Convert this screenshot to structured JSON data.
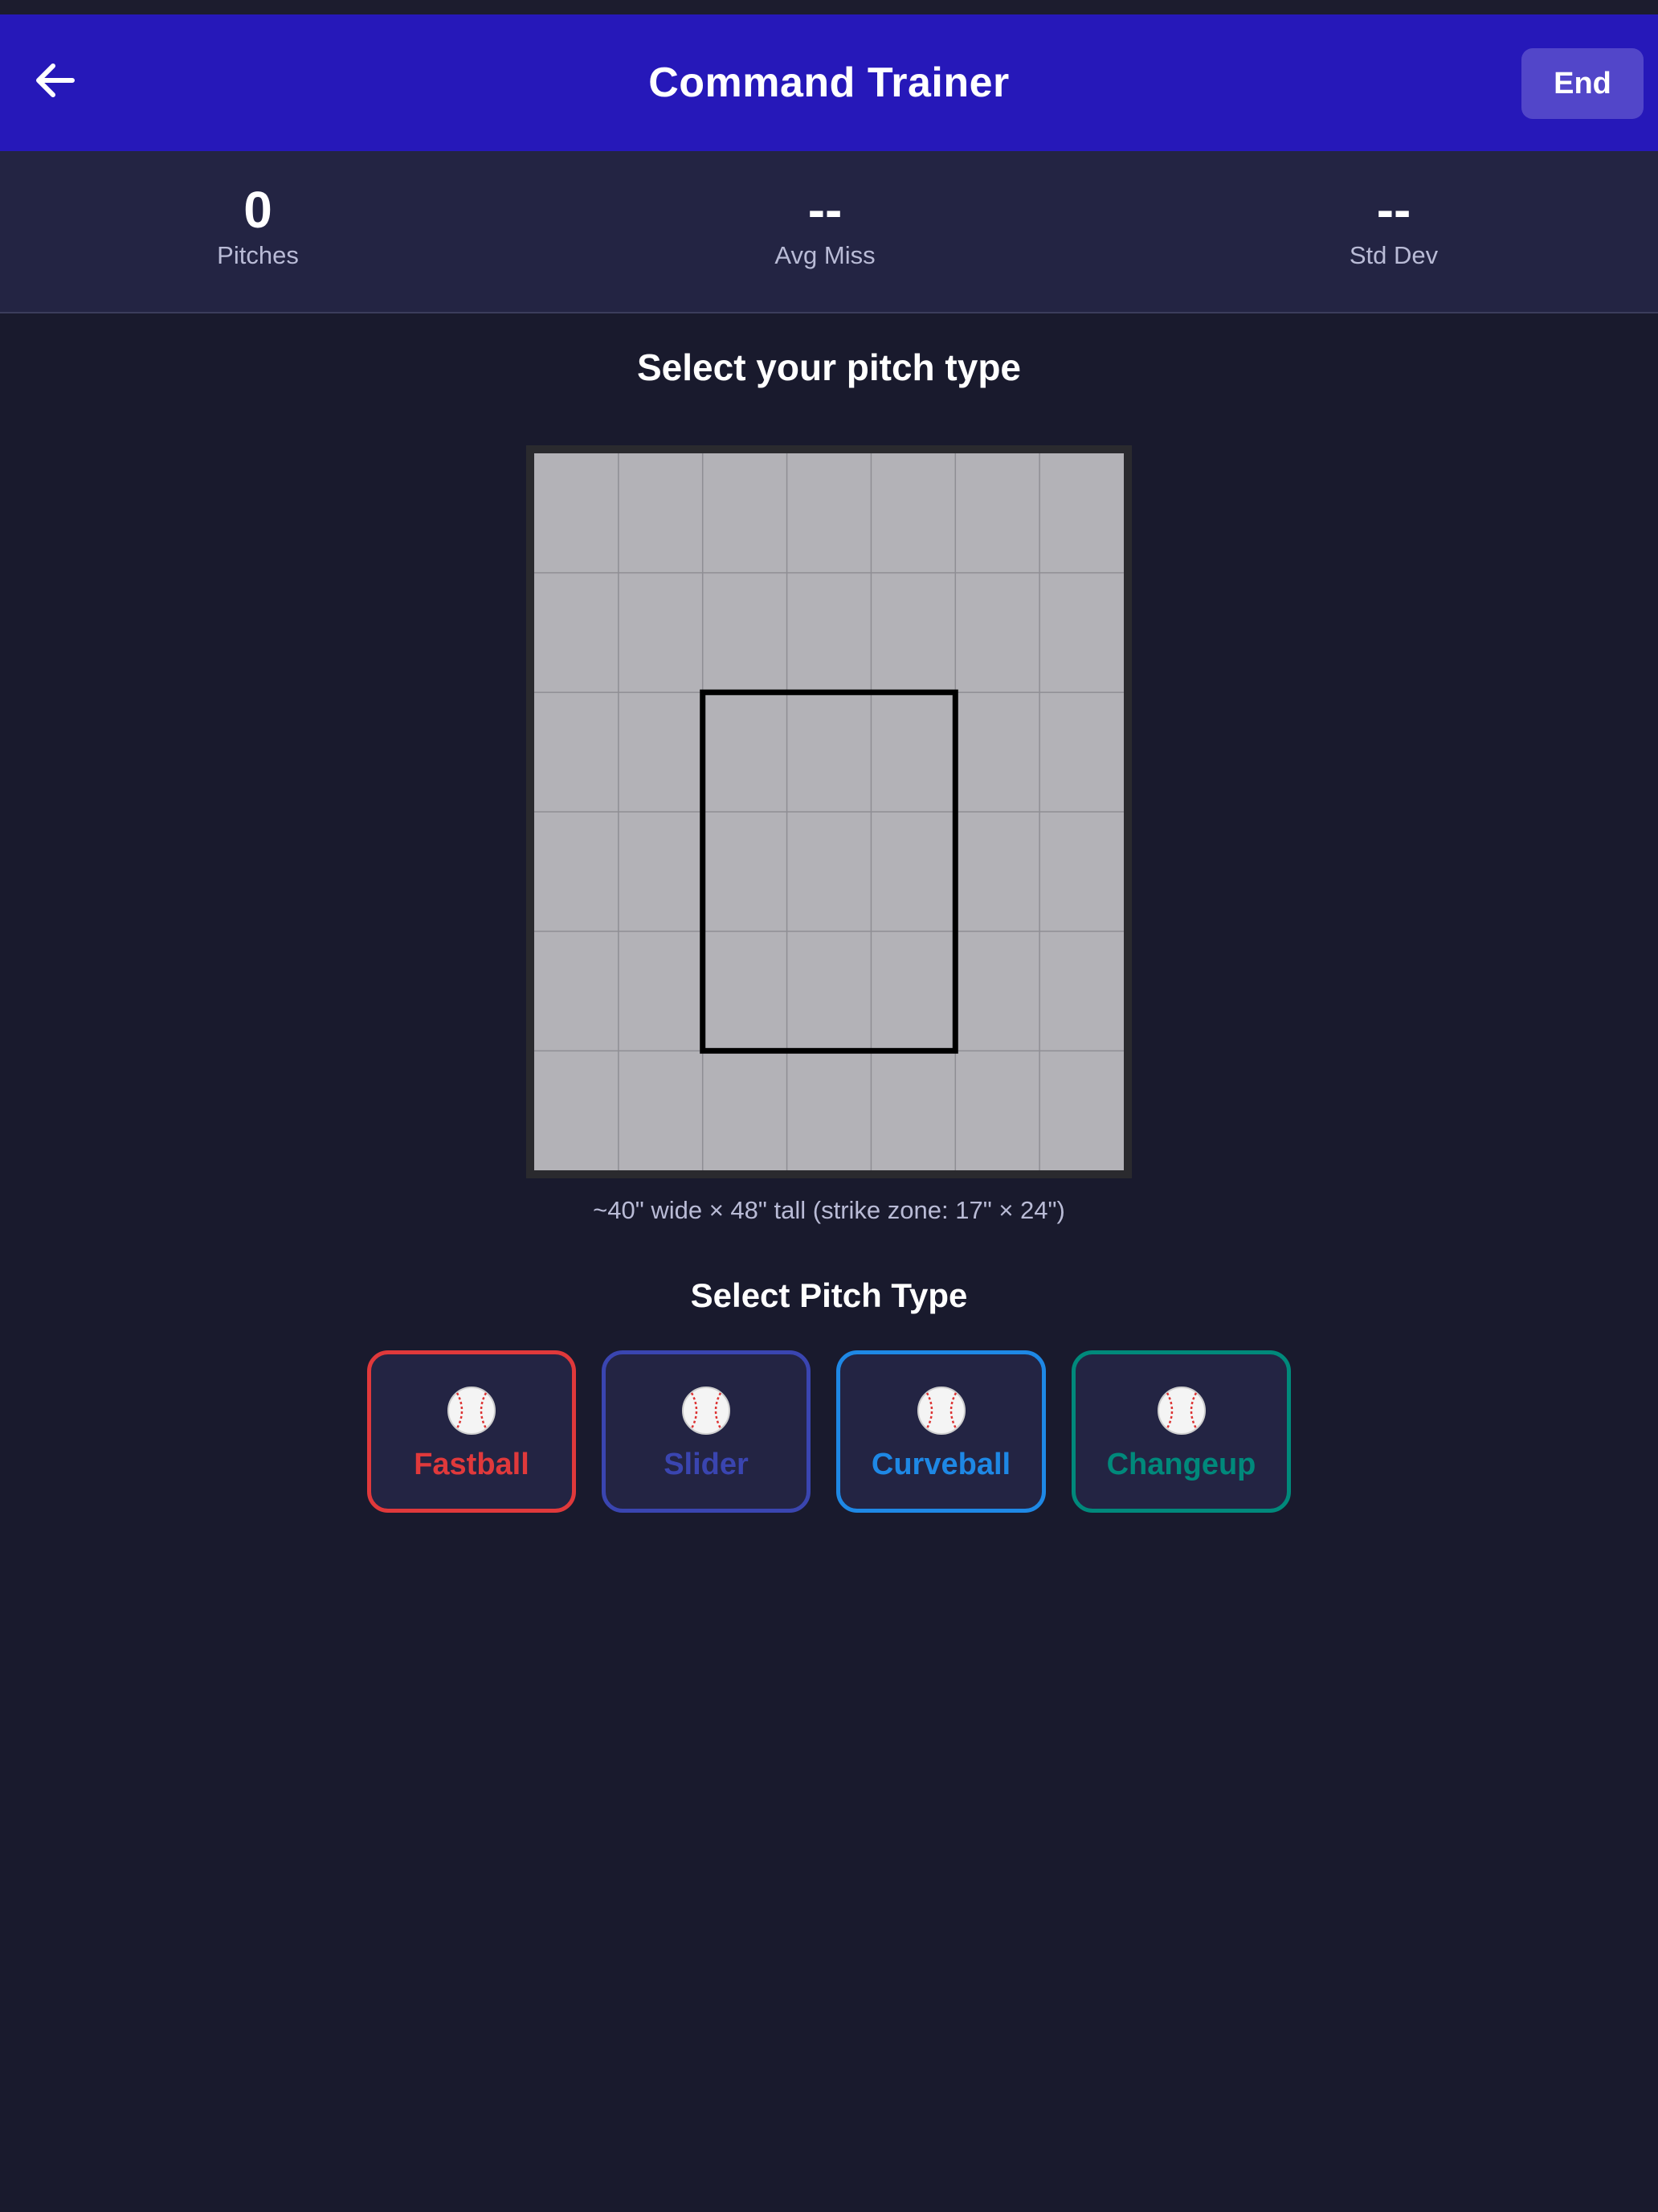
{
  "header": {
    "title": "Command Trainer",
    "back_icon": "arrow-left-icon",
    "end_label": "End",
    "colors": {
      "nav_bg": "#2618b9",
      "end_bg": "#5246c9"
    }
  },
  "stats": [
    {
      "value": "0",
      "label": "Pitches"
    },
    {
      "value": "--",
      "label": "Avg Miss"
    },
    {
      "value": "--",
      "label": "Std Dev"
    }
  ],
  "prompt": {
    "title": "Select your pitch type"
  },
  "zone": {
    "columns": 7,
    "rows": 6,
    "strike_zone_cols": [
      2,
      5
    ],
    "strike_zone_rows": [
      2,
      5
    ],
    "caption": "~40\" wide × 48\" tall (strike zone: 17\" × 24\")"
  },
  "pitch_selector": {
    "title": "Select Pitch Type",
    "icon": "baseball-icon",
    "options": [
      {
        "label": "Fastball",
        "color": "#e0393b"
      },
      {
        "label": "Slider",
        "color": "#3a45b0"
      },
      {
        "label": "Curveball",
        "color": "#1e88e5"
      },
      {
        "label": "Changeup",
        "color": "#00897b"
      }
    ]
  },
  "colors": {
    "background": "#191a2d",
    "stats_bg": "#232443",
    "zone_fill": "#b3b2b7",
    "zone_border": "#2a2a2e"
  }
}
